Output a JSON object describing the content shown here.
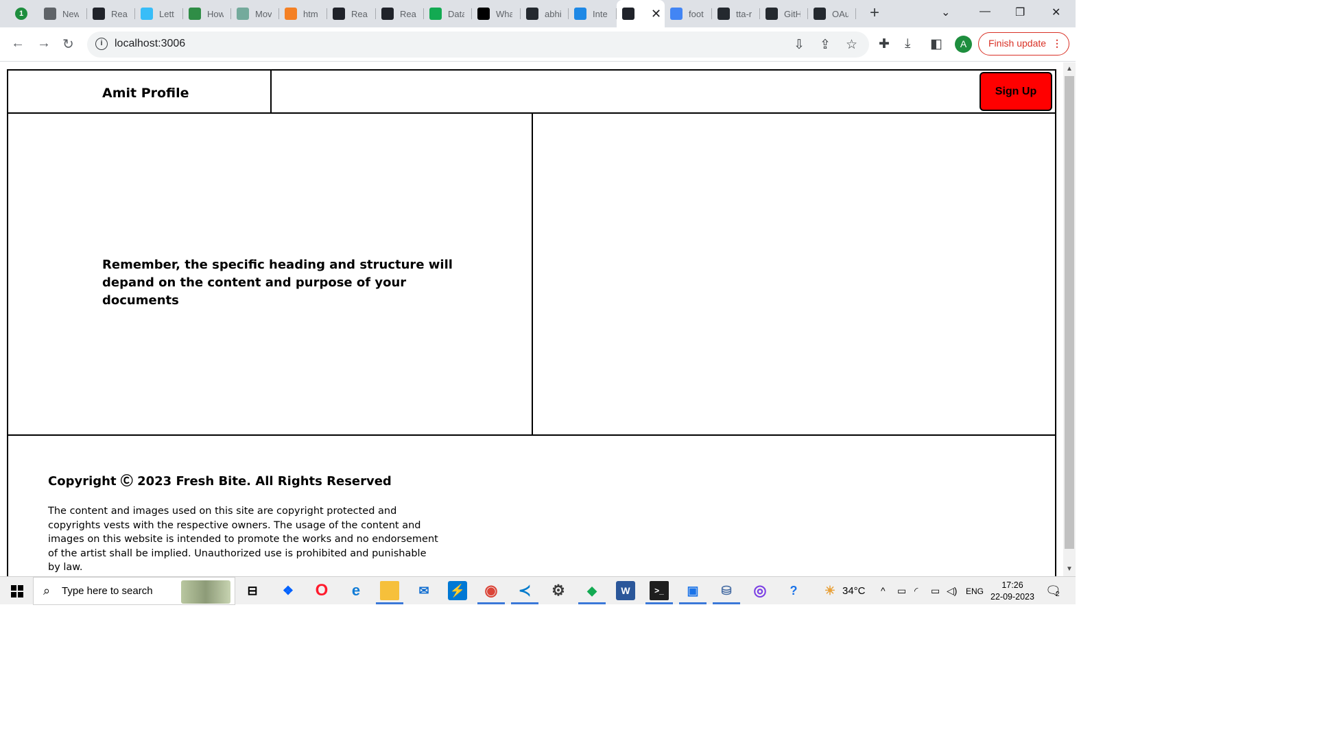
{
  "browser": {
    "tab_badge": "1",
    "tabs": [
      {
        "title": "New",
        "icon": "chrome-icon",
        "color": "#5f6368"
      },
      {
        "title": "Reac",
        "icon": "react-icon",
        "color": "#20232a"
      },
      {
        "title": "Lett",
        "icon": "tailwind-icon",
        "color": "#38bdf8"
      },
      {
        "title": "How",
        "icon": "geeks-icon",
        "color": "#2f8d46"
      },
      {
        "title": "Mov",
        "icon": "openai-icon",
        "color": "#74aa9c"
      },
      {
        "title": "htm",
        "icon": "stackoverflow-icon",
        "color": "#f48024"
      },
      {
        "title": "Reac",
        "icon": "react-icon",
        "color": "#20232a"
      },
      {
        "title": "Reac",
        "icon": "react-icon",
        "color": "#20232a"
      },
      {
        "title": "Data",
        "icon": "mongodb-icon",
        "color": "#13aa52"
      },
      {
        "title": "Wha",
        "icon": "medium-icon",
        "color": "#000000"
      },
      {
        "title": "abhi",
        "icon": "github-icon",
        "color": "#24292f"
      },
      {
        "title": "Inte",
        "icon": "is-icon",
        "color": "#1e88e5"
      },
      {
        "title": "",
        "icon": "react-icon",
        "color": "#20232a",
        "active": true
      },
      {
        "title": "foot",
        "icon": "google-icon",
        "color": "#4285f4"
      },
      {
        "title": "tta-r",
        "icon": "github-icon",
        "color": "#24292f"
      },
      {
        "title": "GitH",
        "icon": "github-icon",
        "color": "#24292f"
      },
      {
        "title": "OAu",
        "icon": "github-icon",
        "color": "#24292f"
      }
    ],
    "url": "localhost:3006",
    "profile_initial": "A",
    "finish_update_label": "Finish update"
  },
  "page": {
    "brand": "Amit Profile",
    "signup_label": "Sign Up",
    "heading": "Remember, the specific heading and structure will depand on the content and purpose of your documents",
    "footer": {
      "copyright": "Copyright Ⓒ 2023 Fresh Bite. All Rights Reserved",
      "disclaimer": "The content and images used on this site are copyright protected and copyrights vests with the respective owners. The usage of the content and images on this website is intended to promote the works and no endorsement of the artist shall be implied. Unauthorized use is prohibited and punishable by law."
    }
  },
  "taskbar": {
    "search_placeholder": "Type here to search",
    "weather": "34°C",
    "language": "ENG",
    "time": "17:26",
    "date": "22-09-2023",
    "notification_count": "2"
  }
}
